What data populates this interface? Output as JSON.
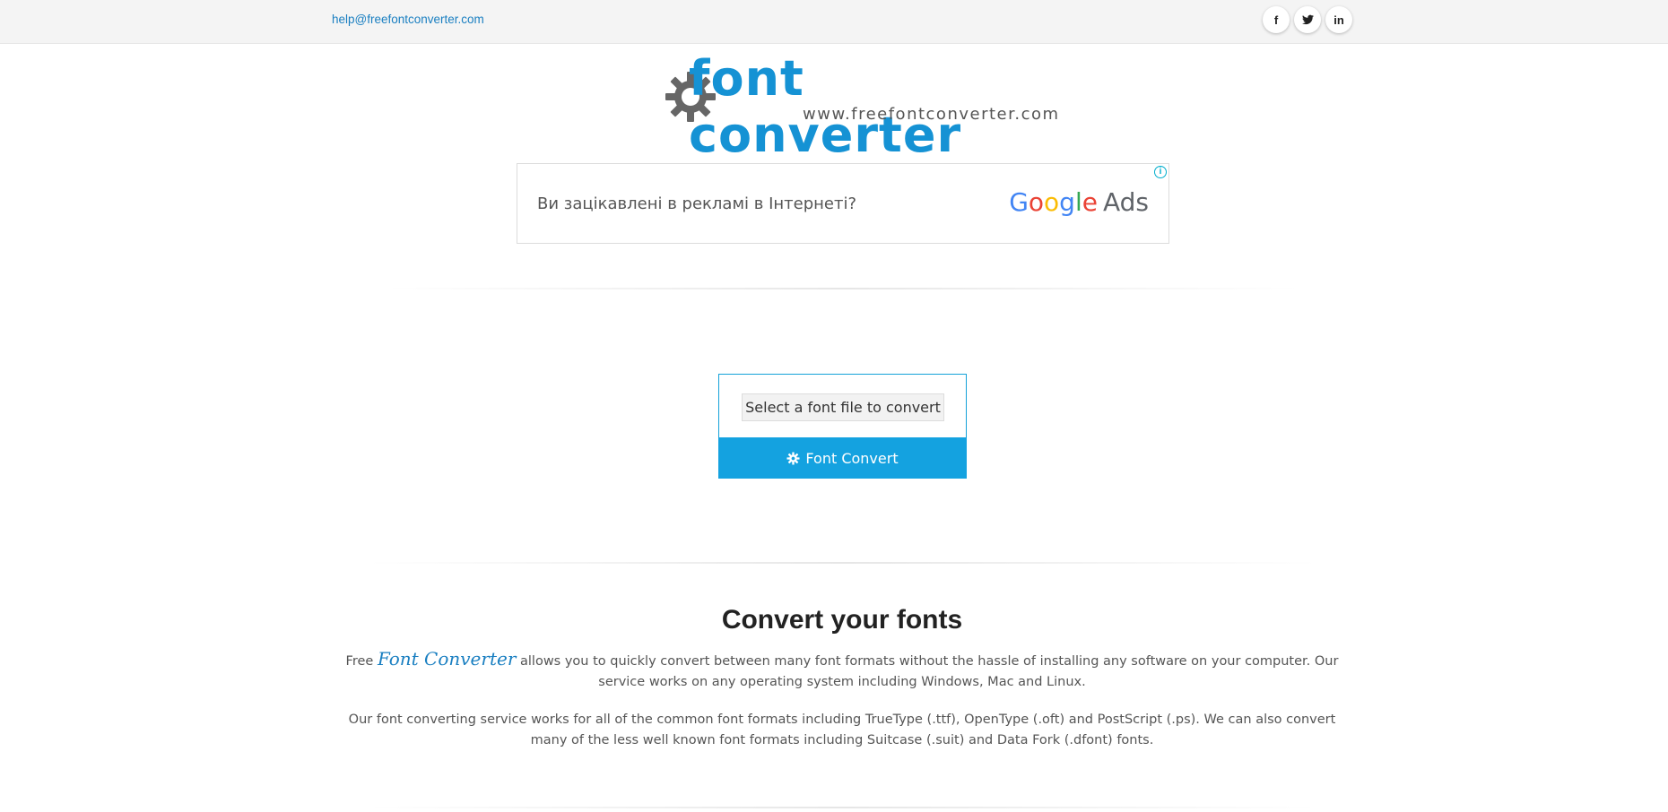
{
  "topbar": {
    "email": "help@freefontconverter.com",
    "socials": [
      {
        "icon": "facebook-icon",
        "glyph": "f"
      },
      {
        "icon": "twitter-icon",
        "glyph": "t"
      },
      {
        "icon": "linkedin-icon",
        "glyph": "in"
      }
    ]
  },
  "logo": {
    "title": "font converter",
    "url": "www.freefontconverter.com"
  },
  "ad": {
    "text": "Ви зацікавлені в рекламі в Інтернеті?",
    "brand": "Google Ads",
    "info_icon": "i"
  },
  "converter": {
    "file_button": "Select a font file to convert",
    "convert_button": "Font Convert"
  },
  "content": {
    "heading": "Convert your fonts",
    "para1_prefix": "Free ",
    "para1_brand": "Font Converter",
    "para1_suffix": " allows you to quickly convert between many font formats without the hassle of installing any software on your computer. Our service works on any operating system including Windows, Mac and Linux.",
    "para2": "Our font converting service works for all of the common font formats including TrueType (.ttf), OpenType (.oft) and PostScript (.ps). We can also convert many of the less well known font formats including Suitcase (.suit) and Data Fork (.dfont) fonts."
  },
  "colors": {
    "accent": "#1592d4",
    "button": "#14a2e0",
    "link": "#1a7fc1"
  }
}
